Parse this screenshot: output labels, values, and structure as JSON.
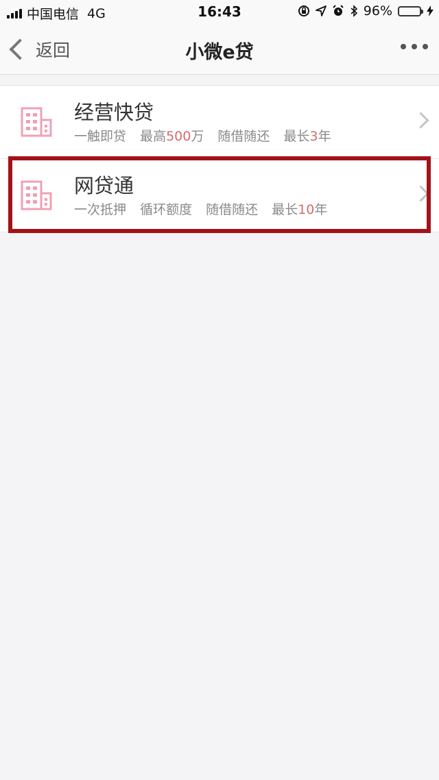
{
  "status_bar": {
    "carrier": "中国电信",
    "network": "4G",
    "time": "16:43",
    "battery": "96%",
    "battery_level": 0.96,
    "icons": [
      "signal-icon",
      "lock-rotation-icon",
      "location-arrow-icon",
      "alarm-icon",
      "bluetooth-icon",
      "battery-icon",
      "charging-icon"
    ]
  },
  "nav": {
    "back_label": "返回",
    "title": "小微e贷"
  },
  "items": [
    {
      "title": "经营快贷",
      "tags": [
        "一触即贷"
      ],
      "max_pre": "最高",
      "max_amount": "500",
      "max_unit": "万",
      "repay": "随借随还",
      "term_pre": "最长",
      "term_value": "3",
      "term_unit": "年"
    },
    {
      "title": "网贷通",
      "tags": [
        "一次抵押",
        "循环额度"
      ],
      "repay": "随借随还",
      "term_pre": "最长",
      "term_value": "10",
      "term_unit": "年"
    }
  ],
  "colors": {
    "icon_pink": "#f0a0b4",
    "highlight": "#d36c6c",
    "annotation_box": "#a31218"
  }
}
